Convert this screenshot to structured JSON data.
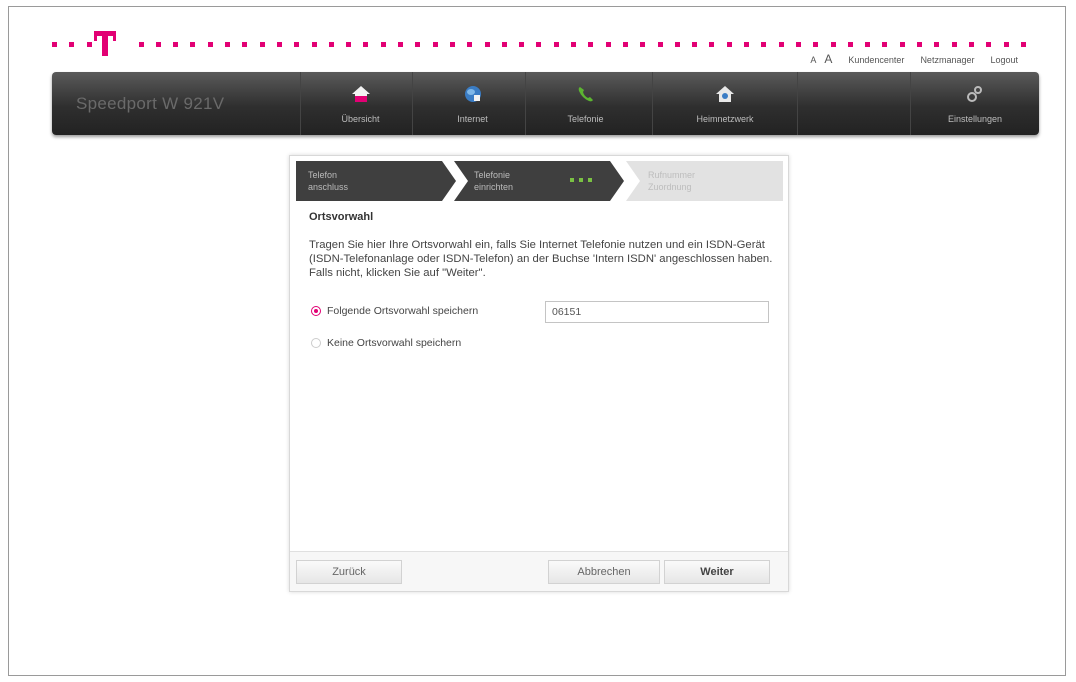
{
  "toplinks": {
    "font_small": "A",
    "font_large": "A",
    "customer_center": "Kundencenter",
    "network_manager": "Netzmanager",
    "logout": "Logout"
  },
  "navbar": {
    "product": "Speedport W 921V",
    "items": [
      {
        "label": "Übersicht",
        "icon": "home-icon"
      },
      {
        "label": "Internet",
        "icon": "globe-icon"
      },
      {
        "label": "Telefonie",
        "icon": "phone-icon"
      },
      {
        "label": "Heimnetzwerk",
        "icon": "house-network-icon"
      },
      {
        "label": "Einstellungen",
        "icon": "settings-icon"
      }
    ]
  },
  "wizard": {
    "steps": [
      {
        "line1": "Telefon",
        "line2": "anschluss"
      },
      {
        "line1": "Telefonie",
        "line2": "einrichten"
      },
      {
        "line1": "Rufnummer",
        "line2": "Zuordnung"
      }
    ],
    "title": "Ortsvorwahl",
    "description": "Tragen Sie hier Ihre Ortsvorwahl ein, falls Sie Internet Telefonie nutzen und ein ISDN-Gerät (ISDN-Telefonanlage oder ISDN-Telefon) an der Buchse 'Intern ISDN' angeschlossen haben. Falls nicht, klicken Sie auf \"Weiter\".",
    "option_save": "Folgende Ortsvorwahl speichern",
    "option_none": "Keine Ortsvorwahl speichern",
    "prefix_value": "06151",
    "buttons": {
      "back": "Zurück",
      "cancel": "Abbrechen",
      "next": "Weiter"
    }
  },
  "colors": {
    "brand": "#e20074",
    "progress": "#7ac143"
  }
}
